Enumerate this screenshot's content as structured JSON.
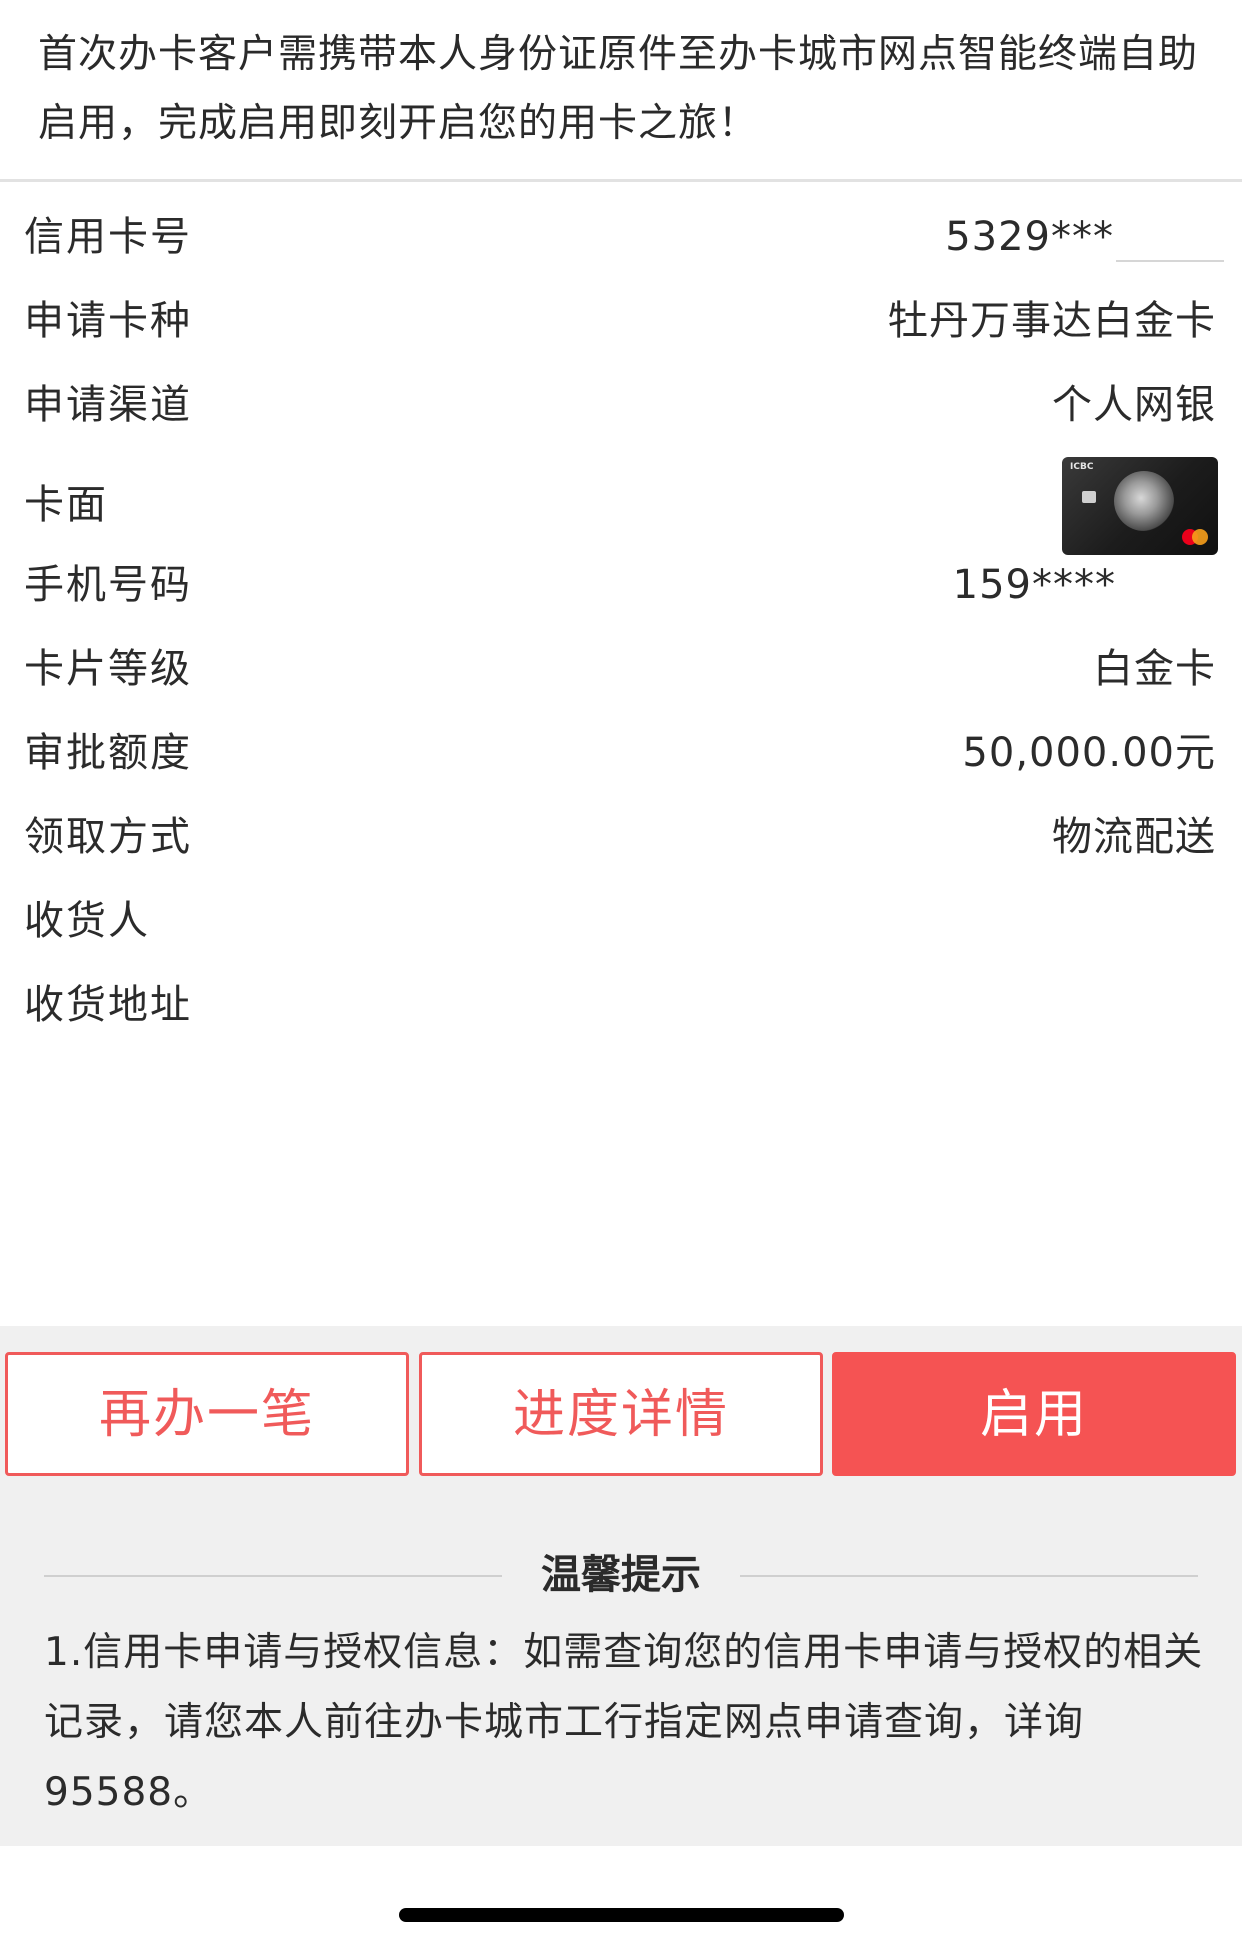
{
  "notice": {
    "text": "首次办卡客户需携带本人身份证原件至办卡城市网点智能终端自助启用，完成启用即刻开启您的用卡之旅！"
  },
  "details": {
    "card_number": {
      "label": "信用卡号",
      "value": "5329***"
    },
    "card_type": {
      "label": "申请卡种",
      "value": "牡丹万事达白金卡"
    },
    "channel": {
      "label": "申请渠道",
      "value": "个人网银"
    },
    "card_face": {
      "label": "卡面",
      "logo_text": "ICBC"
    },
    "phone": {
      "label": "手机号码",
      "value": "159****"
    },
    "card_level": {
      "label": "卡片等级",
      "value": "白金卡"
    },
    "credit_limit": {
      "label": "审批额度",
      "value": "50,000.00元"
    },
    "pickup_method": {
      "label": "领取方式",
      "value": "物流配送"
    },
    "recipient": {
      "label": "收货人",
      "value": ""
    },
    "address": {
      "label": "收货地址",
      "value": ""
    }
  },
  "actions": {
    "apply_again": "再办一笔",
    "progress_details": "进度详情",
    "activate": "启用"
  },
  "tips": {
    "title": "温馨提示",
    "body": "1.信用卡申请与授权信息：如需查询您的信用卡申请与授权的相关记录，请您本人前往办卡城市工行指定网点申请查询，详询95588。"
  },
  "colors": {
    "accent": "#f55353",
    "background_gray": "#f0f0f0"
  }
}
